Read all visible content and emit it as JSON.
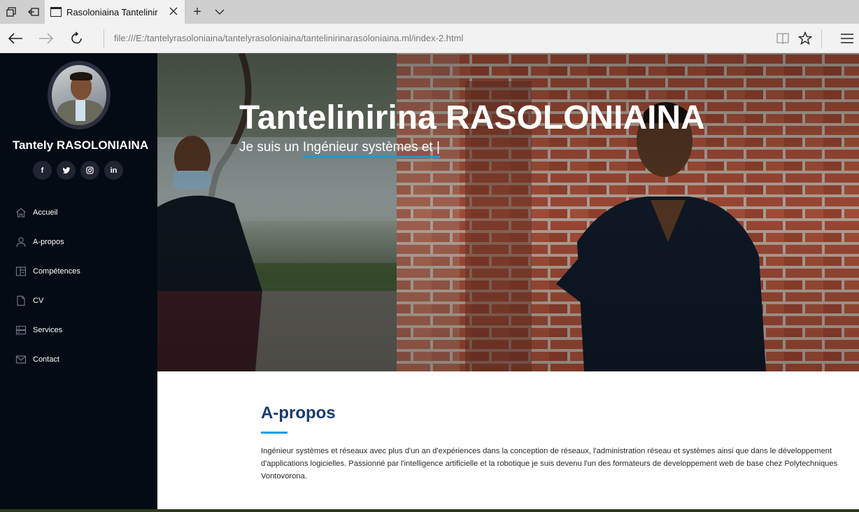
{
  "browser": {
    "tab_title": "Rasoloniaina Tantelinir",
    "address": "file:///E:/tantelyrasoloniaina/tantelyrasoloniaina/tantelinirinarasoloniaina.ml/index-2.html",
    "new_tab_glyph": "+"
  },
  "sidebar": {
    "name": "Tantely RASOLONIAINA",
    "socials": [
      {
        "icon": "facebook-icon",
        "glyph": "f"
      },
      {
        "icon": "twitter-icon",
        "glyph": "t"
      },
      {
        "icon": "instagram-icon",
        "glyph": "◎"
      },
      {
        "icon": "linkedin-icon",
        "glyph": "in"
      }
    ],
    "menu": [
      {
        "label": "Accueil",
        "icon": "home-icon"
      },
      {
        "label": "A-propos",
        "icon": "user-icon"
      },
      {
        "label": "Compétences",
        "icon": "columns-icon"
      },
      {
        "label": "CV",
        "icon": "file-icon"
      },
      {
        "label": "Services",
        "icon": "server-icon"
      },
      {
        "label": "Contact",
        "icon": "envelope-icon"
      }
    ]
  },
  "hero": {
    "title": "Tantelinirina RASOLONIAINA",
    "subtitle_prefix": "Je suis un ",
    "subtitle_typed": "Ingénieur systèmes et |"
  },
  "about": {
    "heading": "A-propos",
    "text": "Ingénieur systèmes et réseaux avec plus d'un an d'expériences dans la conception de réseaux, l'administration réseau et systèmes ainsi que dans le développement d'applications logicielles. Passionné par l'intelligence artificielle et la robotique je suis devenu l'un des formateurs de developpement web de base chez Polytechniques Vontovorona."
  },
  "colors": {
    "sidebar_bg": "#040b14",
    "accent": "#149ddd",
    "heading": "#173b6c"
  }
}
